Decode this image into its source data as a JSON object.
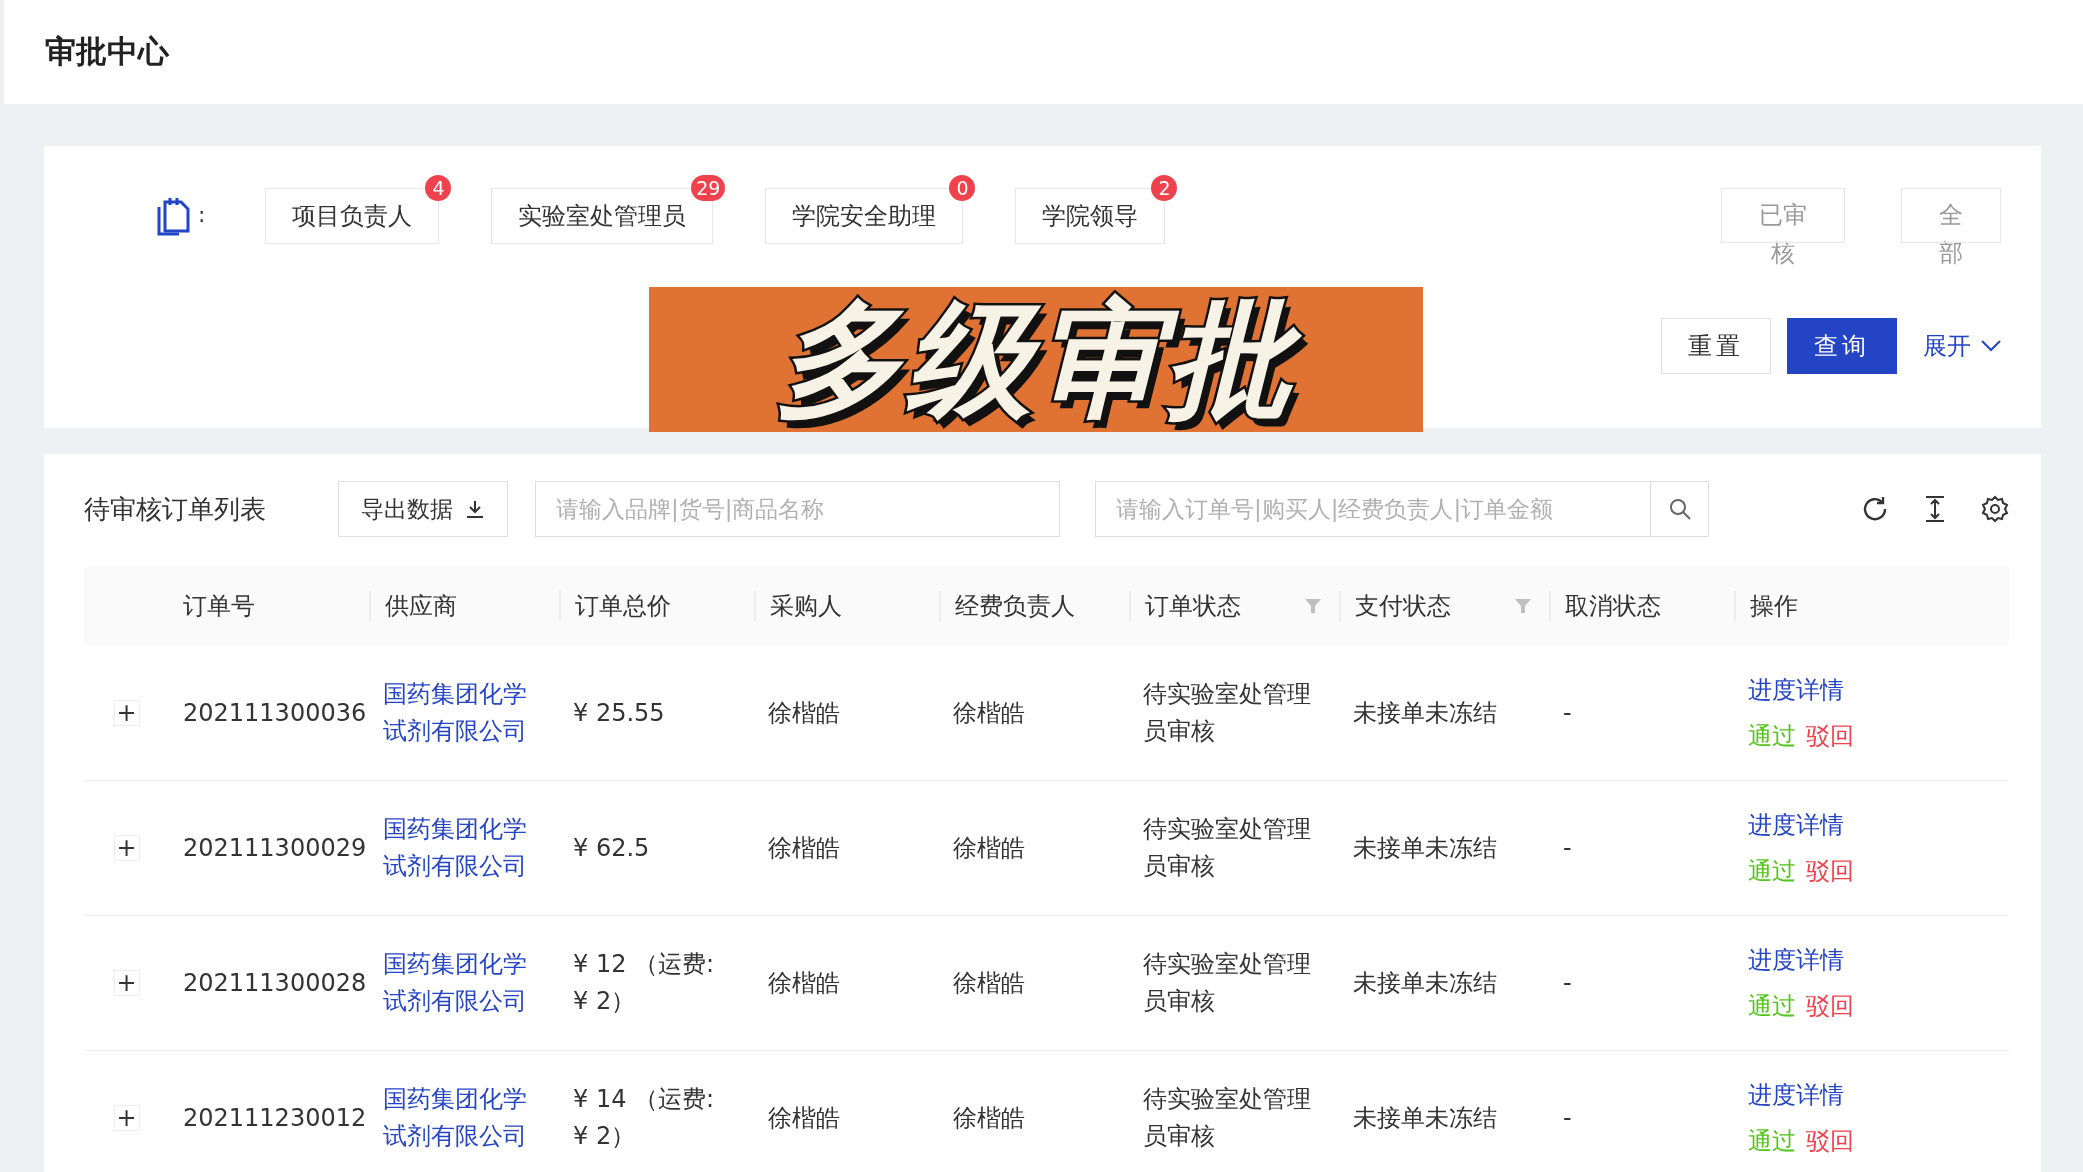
{
  "page_title": "审批中心",
  "role_label_colon": ":",
  "role_tabs": [
    {
      "label": "项目负责人",
      "badge": "4",
      "selected": false
    },
    {
      "label": "实验室处管理员",
      "badge": "29",
      "selected": false
    },
    {
      "label": "学院安全助理",
      "badge": "0",
      "selected": false
    },
    {
      "label": "学院领导",
      "badge": "2",
      "selected": false
    }
  ],
  "filter_buttons": [
    "已审核",
    "全部"
  ],
  "reset_button": "重置",
  "query_button": "查询",
  "expand_link": "展开",
  "overlay_caption": "多级审批",
  "list_title": "待审核订单列表",
  "export_button": "导出数据",
  "search_product": {
    "placeholder": "请输入品牌|货号|商品名称"
  },
  "search_order": {
    "placeholder": "请输入订单号|购买人|经费负责人|订单金额"
  },
  "table": {
    "columns": [
      {
        "label": "订单号",
        "filterable": false
      },
      {
        "label": "供应商",
        "filterable": false
      },
      {
        "label": "订单总价",
        "filterable": false
      },
      {
        "label": "采购人",
        "filterable": false
      },
      {
        "label": "经费负责人",
        "filterable": false
      },
      {
        "label": "订单状态",
        "filterable": true
      },
      {
        "label": "支付状态",
        "filterable": true
      },
      {
        "label": "取消状态",
        "filterable": false
      },
      {
        "label": "操作",
        "filterable": false
      }
    ],
    "rows": [
      {
        "expand": "+",
        "order_no": "202111300036",
        "supplier": "国药集团化学试剂有限公司",
        "total": "¥ 25.55",
        "buyer": "徐楷皓",
        "fund_owner": "徐楷皓",
        "order_status": "待实验室处管理员审核",
        "pay_status": "未接单未冻结",
        "cancel_status": "-",
        "actions": [
          {
            "label": "进度详情",
            "kind": "detail"
          },
          {
            "label": "通过",
            "kind": "approve"
          },
          {
            "label": "驳回",
            "kind": "reject"
          }
        ]
      },
      {
        "expand": "+",
        "order_no": "202111300029",
        "supplier": "国药集团化学试剂有限公司",
        "total": "¥ 62.5",
        "buyer": "徐楷皓",
        "fund_owner": "徐楷皓",
        "order_status": "待实验室处管理员审核",
        "pay_status": "未接单未冻结",
        "cancel_status": "-",
        "actions": [
          {
            "label": "进度详情",
            "kind": "detail"
          },
          {
            "label": "通过",
            "kind": "approve"
          },
          {
            "label": "驳回",
            "kind": "reject"
          }
        ]
      },
      {
        "expand": "+",
        "order_no": "202111300028",
        "supplier": "国药集团化学试剂有限公司",
        "total": "¥ 12 （运费:¥ 2）",
        "buyer": "徐楷皓",
        "fund_owner": "徐楷皓",
        "order_status": "待实验室处管理员审核",
        "pay_status": "未接单未冻结",
        "cancel_status": "-",
        "actions": [
          {
            "label": "进度详情",
            "kind": "detail"
          },
          {
            "label": "通过",
            "kind": "approve"
          },
          {
            "label": "驳回",
            "kind": "reject"
          }
        ]
      },
      {
        "expand": "+",
        "order_no": "202111230012",
        "supplier": "国药集团化学试剂有限公司",
        "total": "¥ 14 （运费:¥ 2）",
        "buyer": "徐楷皓",
        "fund_owner": "徐楷皓",
        "order_status": "待实验室处管理员审核",
        "pay_status": "未接单未冻结",
        "cancel_status": "-",
        "actions": [
          {
            "label": "进度详情",
            "kind": "detail"
          },
          {
            "label": "通过",
            "kind": "approve"
          },
          {
            "label": "驳回",
            "kind": "reject"
          }
        ]
      }
    ]
  }
}
